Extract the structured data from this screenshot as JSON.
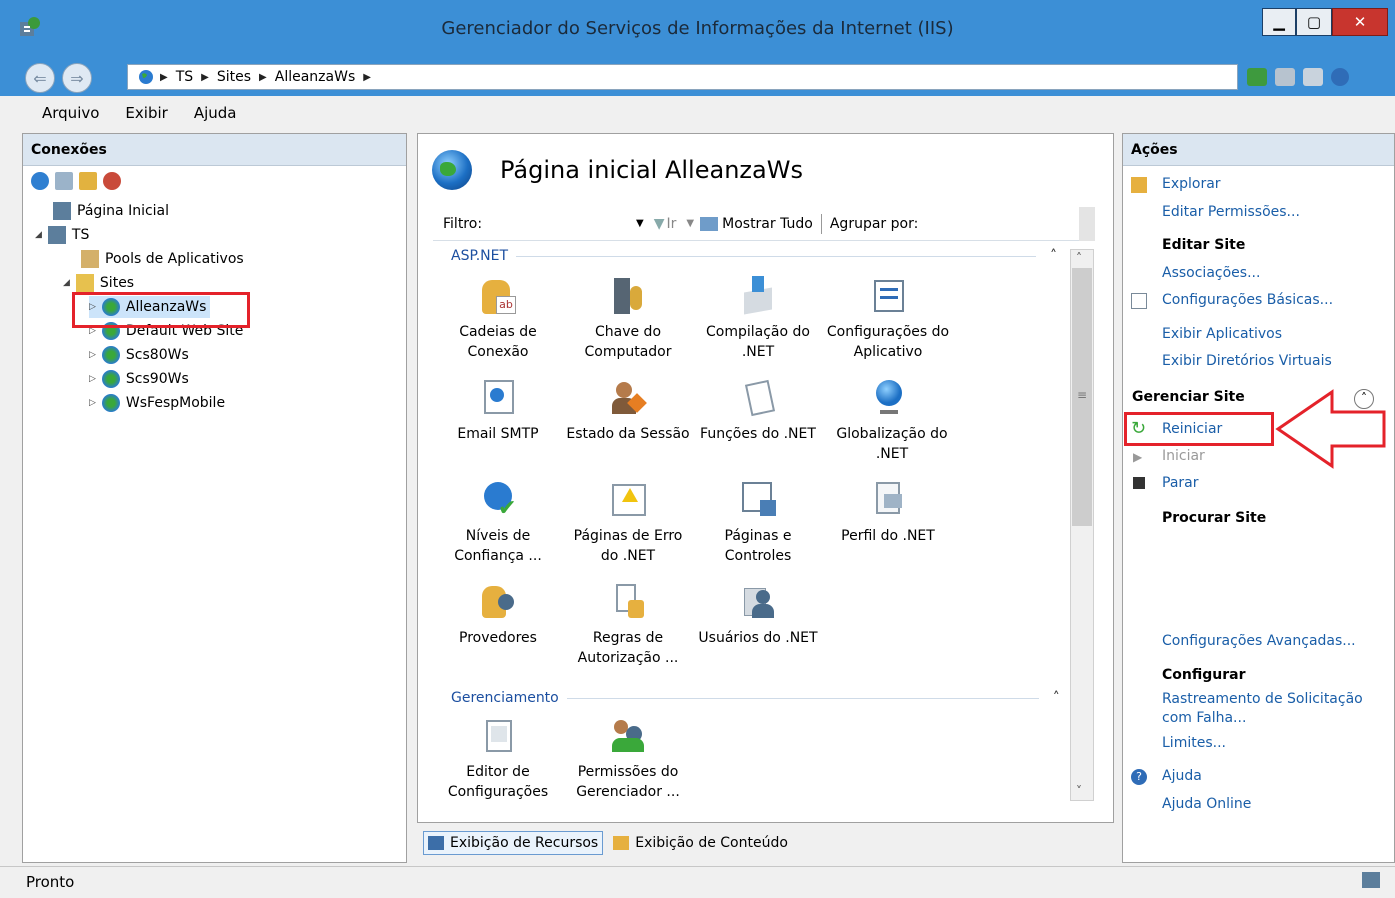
{
  "window": {
    "title": "Gerenciador do Serviços de Informações da Internet (IIS)"
  },
  "address": {
    "crumbs": [
      "TS",
      "Sites",
      "AlleanzaWs"
    ]
  },
  "menu": {
    "file": "Arquivo",
    "view": "Exibir",
    "help": "Ajuda"
  },
  "connections": {
    "header": "Conexões",
    "tree": {
      "start_page": "Página Inicial",
      "server": "TS",
      "app_pools": "Pools de Aplicativos",
      "sites": "Sites",
      "site_items": [
        "AlleanzaWs",
        "Default Web Site",
        "Scs80Ws",
        "Scs90Ws",
        "WsFespMobile"
      ]
    }
  },
  "center": {
    "title": "Página inicial AlleanzaWs",
    "filter": {
      "label": "Filtro:",
      "go": "Ir",
      "show_all": "Mostrar Tudo",
      "group_by": "Agrupar por:"
    },
    "groups": {
      "aspnet": "ASP.NET",
      "management": "Gerenciamento"
    },
    "features": [
      "Cadeias de Conexão",
      "Chave do Computador",
      "Compilação do .NET",
      "Configurações do Aplicativo",
      "Email SMTP",
      "Estado da Sessão",
      "Funções do .NET",
      "Globalização do .NET",
      "Níveis de Confiança ...",
      "Páginas de Erro do .NET",
      "Páginas e Controles",
      "Perfil do .NET",
      "Provedores",
      "Regras de Autorização ...",
      "Usuários do .NET"
    ],
    "management_features": [
      "Editor de Configurações",
      "Permissões do Gerenciador ..."
    ],
    "view_tabs": {
      "features": "Exibição de Recursos",
      "content": "Exibição de Conteúdo"
    }
  },
  "actions": {
    "header": "Ações",
    "explore": "Explorar",
    "edit_permissions": "Editar Permissões...",
    "edit_site": "Editar Site",
    "bindings": "Associações...",
    "basic_settings": "Configurações Básicas...",
    "view_apps": "Exibir Aplicativos",
    "view_vdirs": "Exibir Diretórios Virtuais",
    "manage_site": "Gerenciar Site",
    "restart": "Reiniciar",
    "start": "Iniciar",
    "stop": "Parar",
    "browse_site": "Procurar Site",
    "advanced_settings": "Configurações Avançadas...",
    "configure": "Configurar",
    "failed_request": "Rastreamento de Solicitação com Falha...",
    "limits": "Limites...",
    "help": "Ajuda",
    "online_help": "Ajuda Online"
  },
  "status": {
    "text": "Pronto"
  },
  "colors": {
    "annotation": "#e4222a",
    "link": "#1a5ea8",
    "titlebar": "#3c8fd6"
  }
}
